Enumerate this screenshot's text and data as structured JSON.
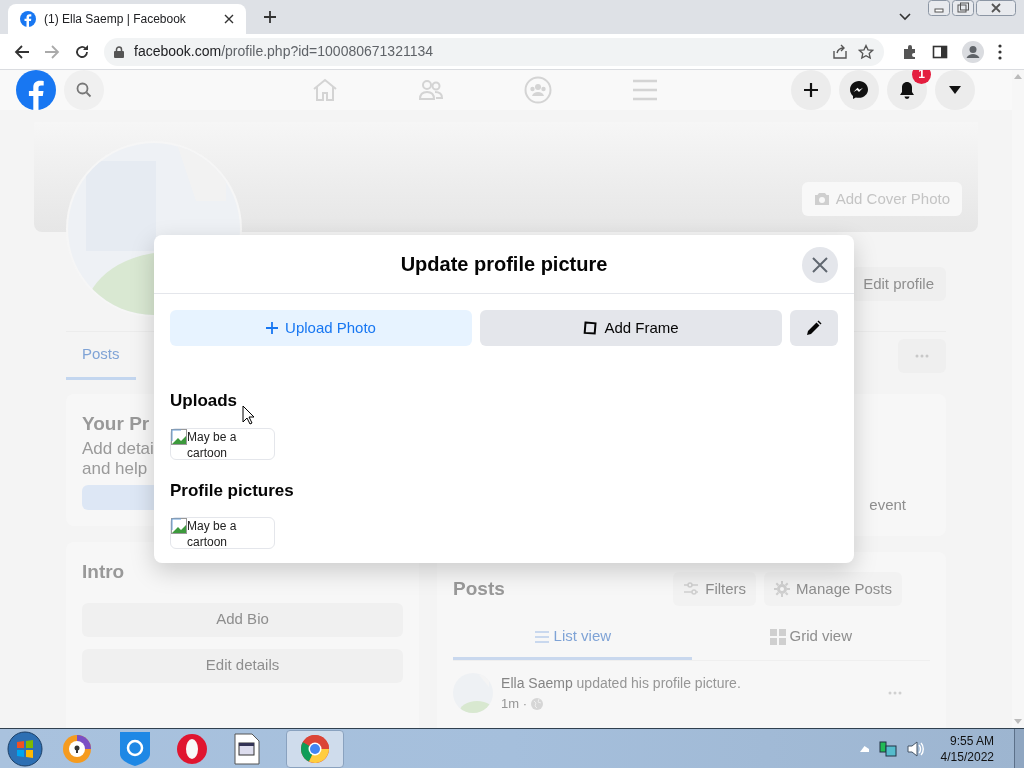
{
  "browser": {
    "tab_title": "(1) Ella Saemp | Facebook",
    "url_domain": "facebook.com",
    "url_path": "/profile.php?id=100080671321134"
  },
  "fb_header": {
    "notification_count": "1"
  },
  "profile": {
    "add_cover_button": "Add Cover Photo",
    "edit_profile_button": "Edit profile",
    "tabs": [
      {
        "label": "Posts",
        "selected": true
      }
    ]
  },
  "left_column": {
    "profile_card": {
      "title": "Your Pr",
      "lines": [
        "Add detai",
        "and help"
      ]
    },
    "intro": {
      "title": "Intro",
      "buttons": [
        "Add Bio",
        "Edit details"
      ]
    }
  },
  "right_column": {
    "event_text": "event",
    "posts": {
      "title": "Posts",
      "actions": [
        {
          "kind": "filter",
          "label": "Filters"
        },
        {
          "kind": "manage",
          "label": "Manage Posts"
        }
      ],
      "views": [
        {
          "kind": "list",
          "label": "List view",
          "selected": true
        },
        {
          "kind": "grid",
          "label": "Grid view",
          "selected": false
        }
      ],
      "post": {
        "author": "Ella Saemp",
        "action": "updated his profile picture.",
        "time": "1m ·"
      }
    }
  },
  "modal": {
    "title": "Update profile picture",
    "upload_button": "Upload Photo",
    "frame_button": "Add Frame",
    "sections": [
      {
        "heading": "Uploads",
        "items": [
          {
            "alt": "May be a cartoon"
          }
        ]
      },
      {
        "heading": "Profile pictures",
        "items": [
          {
            "alt": "May be a cartoon"
          }
        ]
      }
    ]
  },
  "taskbar": {
    "time": "9:55 AM",
    "date": "4/15/2022"
  }
}
